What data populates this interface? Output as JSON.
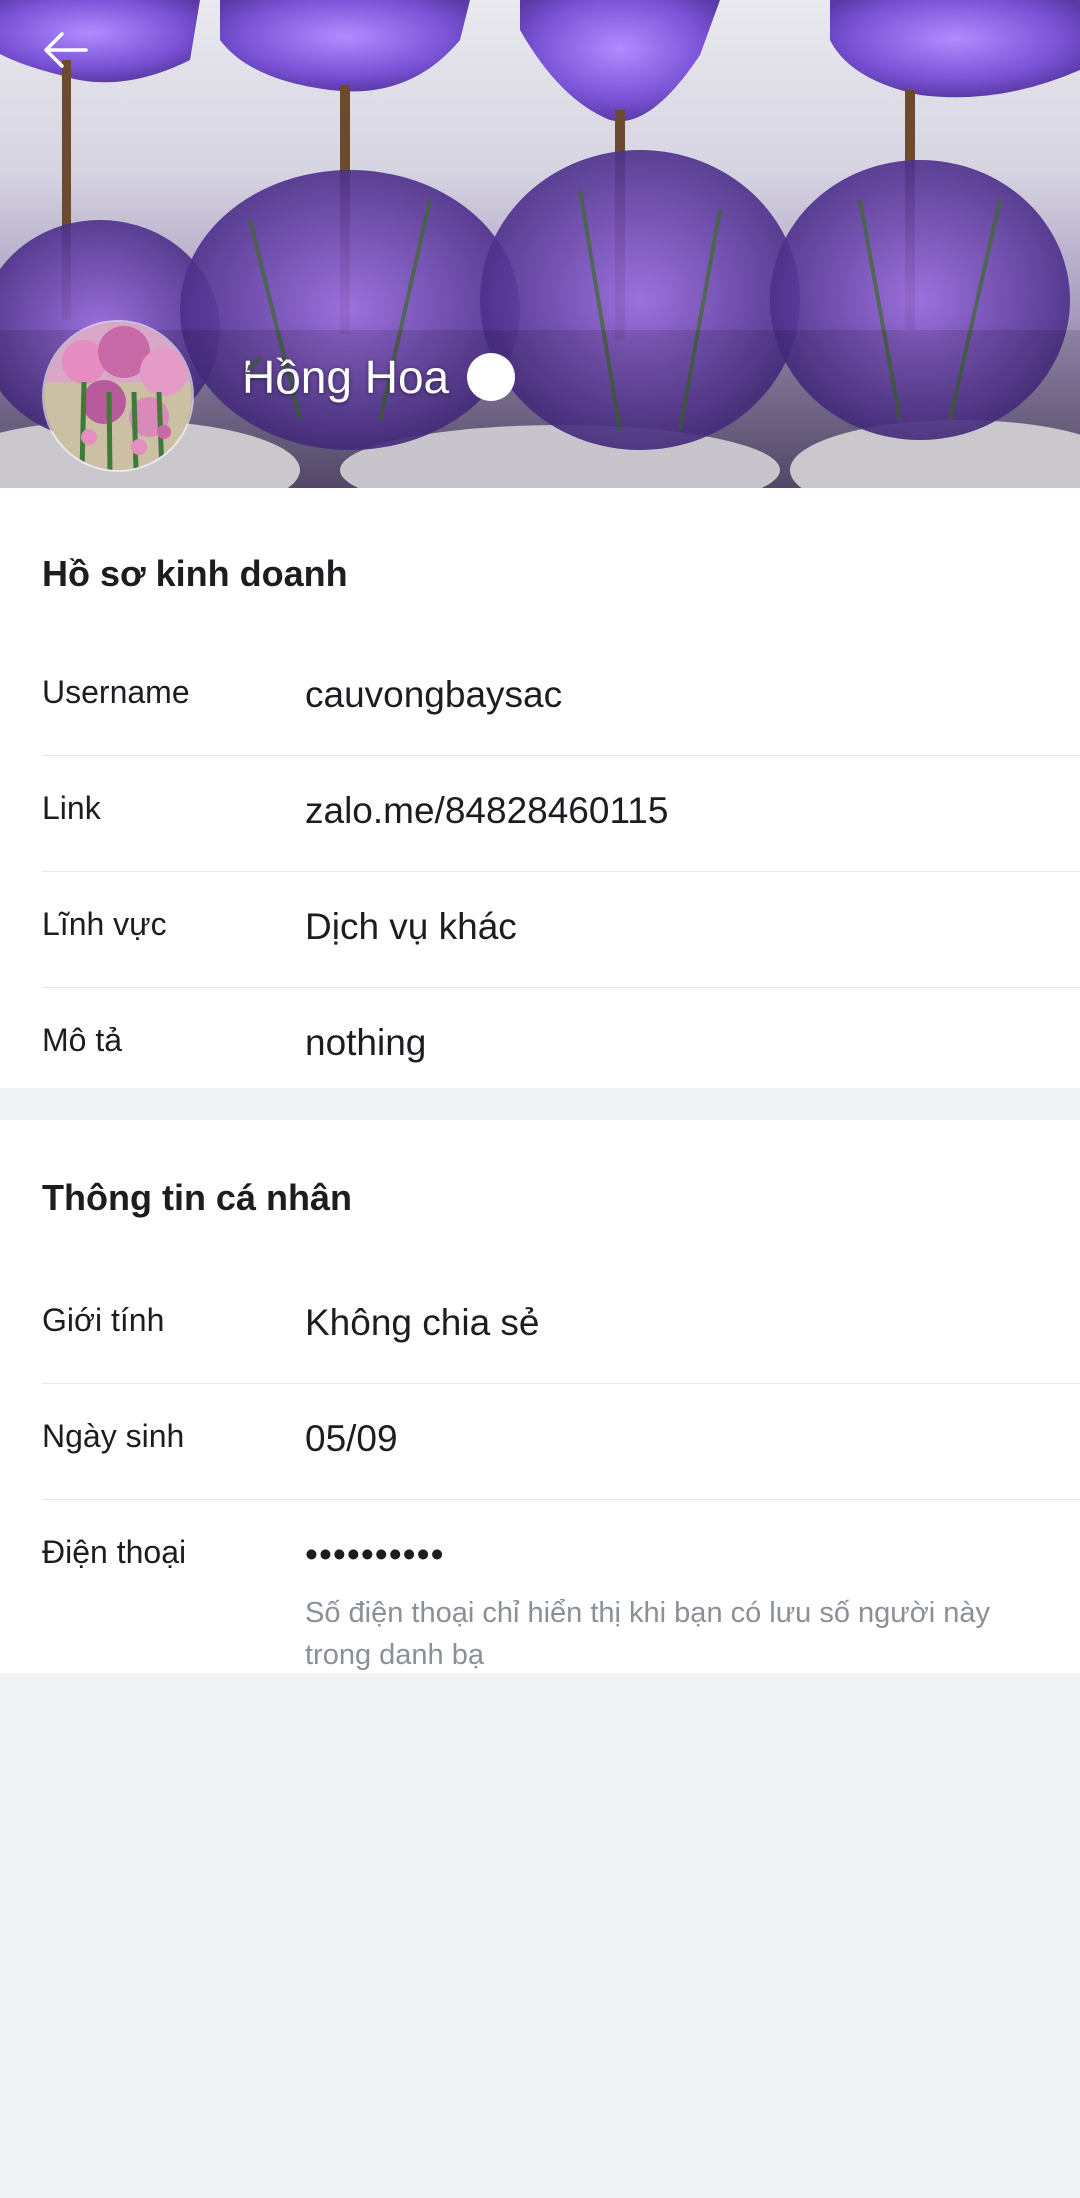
{
  "header": {
    "profile_name": "Hồng Hoa"
  },
  "business_profile": {
    "title": "Hồ sơ kinh doanh",
    "rows": [
      {
        "label": "Username",
        "value": "cauvongbaysac"
      },
      {
        "label": "Link",
        "value": "zalo.me/84828460115"
      },
      {
        "label": "Lĩnh vực",
        "value": "Dịch vụ khác"
      },
      {
        "label": "Mô tả",
        "value": "nothing"
      }
    ]
  },
  "personal_info": {
    "title": "Thông tin cá nhân",
    "rows": [
      {
        "label": "Giới tính",
        "value": "Không chia sẻ"
      },
      {
        "label": "Ngày sinh",
        "value": "05/09"
      },
      {
        "label": "Điện thoại",
        "value": "••••••••••",
        "note": "Số điện thoại chỉ hiển thị khi bạn có lưu số người này trong danh bạ"
      }
    ]
  },
  "icons": {
    "back": "arrow-left-icon",
    "edit": "pencil-icon"
  },
  "colors": {
    "page_background": "#f1f2f4",
    "card_background": "#ffffff",
    "divider": "#e4e6ea",
    "muted_text": "#8a9098",
    "cover_purple": "#7a52d6"
  }
}
